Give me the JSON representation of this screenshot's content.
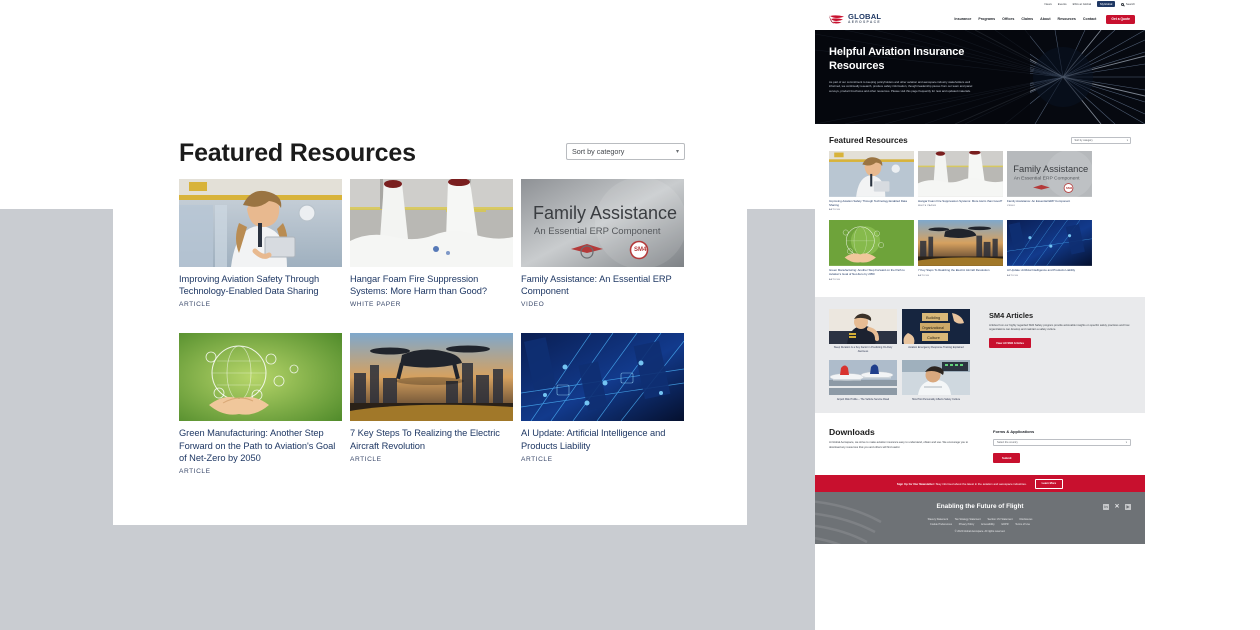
{
  "zoom_panel": {
    "section_title": "Featured Resources",
    "sort_select": {
      "value": "Sort by category",
      "caret": "chevron-down-icon"
    },
    "cards": [
      {
        "title": "Improving Aviation Safety Through Technology-Enabled Data Sharing",
        "kind": "ARTICLE",
        "image": "businesswoman-with-tablet-in-airport"
      },
      {
        "title": "Hangar Foam Fire Suppression Systems: More Harm than Good?",
        "kind": "WHITE PAPER",
        "image": "hangar-foam-discharge"
      },
      {
        "title": "Family Assistance: An Essential ERP Component",
        "kind": "VIDEO",
        "image": "family-assistance-video-title-card",
        "overlay_title": "Family Assistance",
        "overlay_subtitle": "An Essential ERP Component"
      },
      {
        "title": "Green Manufacturing: Another Step Forward on the Path to Aviation's Goal of Net-Zero by 2050",
        "kind": "ARTICLE",
        "image": "green-hands-globe-icons"
      },
      {
        "title": "7 Key Steps To Realizing the Electric Aircraft Revolution",
        "kind": "ARTICLE",
        "image": "evtol-over-city-at-dusk"
      },
      {
        "title": "AI Update: Artificial Intelligence and Products Liability",
        "kind": "ARTICLE",
        "image": "blue-circuit-city-network"
      }
    ]
  },
  "site": {
    "utility_nav": [
      "News",
      "Events",
      "ESG at Global",
      "MyGlobal",
      "Search"
    ],
    "utility_active": "MyGlobal",
    "brand": {
      "name": "GLOBAL",
      "sub": "AEROSPACE"
    },
    "main_nav": [
      "Insurance",
      "Programs",
      "Offices",
      "Claims",
      "About",
      "Resources",
      "Contact"
    ],
    "quote_button": "Get a Quote",
    "hero": {
      "heading": "Helpful Aviation Insurance Resources",
      "paragraph": "As part of our commitment to keeping policyholders and other aviation and aerospace industry stakeholders well informed, we continually research, produce safety information, thought leadership pieces from our team and panel surveys, product brochures and other resources. Please visit this page frequently for new and updated materials."
    },
    "featured": {
      "title": "Featured Resources",
      "sort_select": {
        "value": "Sort by category",
        "caret": "chevron-down-icon"
      },
      "cards": [
        {
          "title": "Improving Aviation Safety Through Technology-Enabled Data Sharing",
          "kind": "ARTICLE"
        },
        {
          "title": "Hangar Foam Fire Suppression Systems: More Harm than Good?",
          "kind": "WHITE PAPER"
        },
        {
          "title": "Family Assistance: An Essential ERP Component",
          "kind": "VIDEO"
        },
        {
          "title": "Green Manufacturing: Another Step Forward on the Path to Aviation's Goal of Net-Zero by 2050",
          "kind": "ARTICLE"
        },
        {
          "title": "7 Key Steps To Realizing the Electric Aircraft Revolution",
          "kind": "ARTICLE"
        },
        {
          "title": "AI Update: Artificial Intelligence and Products Liability",
          "kind": "ARTICLE"
        }
      ]
    },
    "sm4": {
      "title": "SM4 Articles",
      "paragraph": "Articles from our highly regarded SM4 Safety program provide actionable insights on specific safety practices and how organizations can develop and maintain a safety culture.",
      "button": "View All SM4 Articles",
      "articles": [
        {
          "title": "Sleep Duration Is a Key Factor in Predicting On-Duty Alertness",
          "image": "tired-pilot-resting"
        },
        {
          "title": "Aviation Emergency Response Training Explained",
          "image": "building-organizational-culture-blocks"
        },
        {
          "title": "Airport Risk Profile – The Vehicle Service Road",
          "image": "parked-airliners-at-gate"
        },
        {
          "title": "How Pilot Personality Affects Safety Culture",
          "image": "pilot-in-cockpit"
        }
      ]
    },
    "downloads": {
      "title": "Downloads",
      "paragraph": "At Global Aerospace, we strive to make aviation insurance easy to understand, obtain and use. We encourage you to download any resources that you and others will find useful.",
      "forms_title": "Forms & Applications",
      "country_select": {
        "value": "Select the country",
        "caret": "chevron-down-icon"
      },
      "submit_button": "Submit"
    },
    "newsletter": {
      "bold": "Sign Up for Our Newsletter:",
      "text": " Stay informed about the latest in the aviation and aerospace industries.",
      "button": "Learn More"
    },
    "footer": {
      "tagline": "Enabling the Future of Flight",
      "social": [
        {
          "name": "linkedin-icon",
          "glyph": "in"
        },
        {
          "name": "x-twitter-icon",
          "glyph": "✕"
        },
        {
          "name": "youtube-icon",
          "glyph": "▶"
        }
      ],
      "links_row1": [
        "Slavery Statement",
        "Tax Strategy Statement",
        "Section 172 Statement",
        "Disclosures"
      ],
      "links_row2": [
        "Cookie Preferences",
        "Privacy Policy",
        "Accessibility",
        "GDPR",
        "Terms of Use"
      ],
      "copyright": "© 2024 Global Aerospace. All rights reserved."
    },
    "colors": {
      "brand_red": "#c8102e",
      "brand_navy": "#1f3864",
      "footer_grey": "#6e7276",
      "band_grey": "#e9eaec"
    }
  }
}
